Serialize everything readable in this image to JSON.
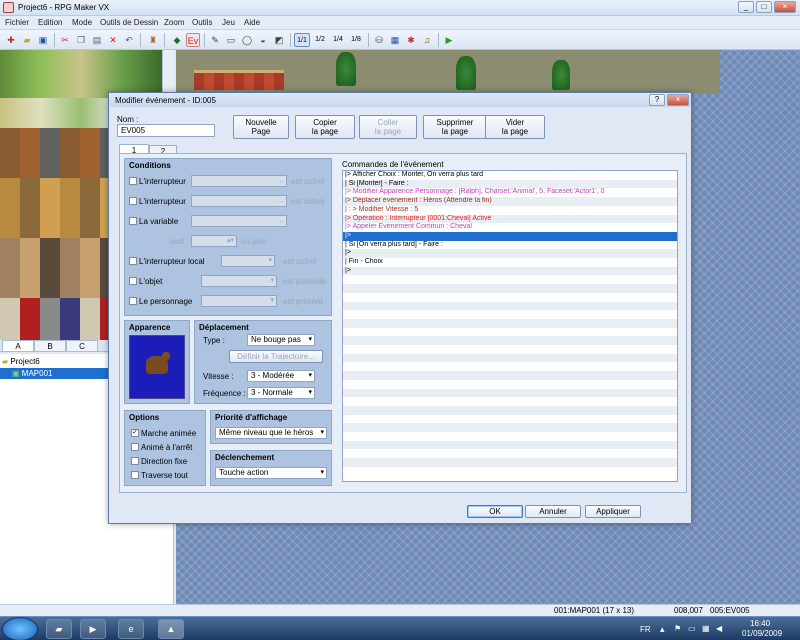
{
  "app": {
    "title": "Project6 - RPG Maker VX",
    "min": "_",
    "max": "□",
    "close": "×"
  },
  "menu": [
    "Fichier",
    "Edition",
    "Mode",
    "Outils de Dessin",
    "Zoom",
    "Outils",
    "Jeu",
    "Aide"
  ],
  "toolbar_zoom": [
    "1/1",
    "1/2",
    "1/4",
    "1/8"
  ],
  "tileset_tabs": [
    "A",
    "B",
    "C"
  ],
  "tree": {
    "project": "Project6",
    "map": "MAP001"
  },
  "statusbar": {
    "map": "001:MAP001 (17 x 13)",
    "coords": "008,007",
    "event": "005:EV005"
  },
  "taskbar": {
    "lang": "FR",
    "time": "16:40",
    "date": "01/09/2009"
  },
  "dialog": {
    "title": "Modifier événement - ID:005",
    "help": "?",
    "close": "×",
    "name_label": "Nom :",
    "name_value": "EV005",
    "page_buttons": [
      "Nouvelle\nPage",
      "Copier\nla page",
      "Coller\nla page",
      "Supprimer\nla page",
      "Vider\nla page"
    ],
    "tabs": [
      "1",
      "2"
    ],
    "conditions": {
      "title": "Conditions",
      "switch1": "L'interrupteur",
      "switch2": "L'interrupteur",
      "variable": "La variable",
      "vaut": "vaut",
      "ou_plus": "ou plus",
      "local_switch": "L'interrupteur local",
      "item": "L'objet",
      "actor": "Le personnage",
      "est_active": "est activé",
      "est_possede": "est possédé",
      "est_present": "est présent"
    },
    "appearance": {
      "title": "Apparence"
    },
    "movement": {
      "title": "Déplacement",
      "type_label": "Type :",
      "type_value": "Ne bouge pas",
      "route_button": "Définir la Trajectoire...",
      "speed_label": "Vitesse :",
      "speed_value": "3 - Modérée",
      "freq_label": "Fréquence :",
      "freq_value": "3 - Normale"
    },
    "options": {
      "title": "Options",
      "walk_anim": "Marche animée",
      "step_anim": "Animé à l'arrêt",
      "dir_fix": "Direction fixe",
      "through": "Traverse tout"
    },
    "priority": {
      "title": "Priorité d'affichage",
      "value": "Même niveau que le héros"
    },
    "trigger": {
      "title": "Déclenchement",
      "value": "Touche action"
    },
    "commands": {
      "title": "Commandes de l'événement",
      "lines": [
        {
          "text": "|> Afficher Choix : Monter, On verra plus tard",
          "color": "#000000"
        },
        {
          "text": "|   Si [Monter] - Faire :",
          "color": "#000000"
        },
        {
          "text": "     |> Modifier Apparence Personnage : [Ralph], Charset:'Animal', 5, Faceset:'Actor1', 0",
          "color": "#c040c0"
        },
        {
          "text": "     |> Déplacer événement : Héros (Attendre la fin)",
          "color": "#a03020"
        },
        {
          "text": "     |                          : > Modifier Vitesse : 5",
          "color": "#a03020"
        },
        {
          "text": "     |> Opération : Interrupteur [0001:Cheval] Activé",
          "color": "#e02020"
        },
        {
          "text": "     |> Appeler Événement Commun : Cheval",
          "color": "#c040c0"
        },
        {
          "text": "     |>",
          "color": "#ffffff"
        },
        {
          "text": "|   Si [On verra plus tard] - Faire :",
          "color": "#000000"
        },
        {
          "text": "     |>",
          "color": "#000000"
        },
        {
          "text": "|   Fin - Choix",
          "color": "#000000"
        },
        {
          "text": "|>",
          "color": "#000000"
        }
      ]
    },
    "buttons": {
      "ok": "OK",
      "cancel": "Annuler",
      "apply": "Appliquer"
    }
  }
}
